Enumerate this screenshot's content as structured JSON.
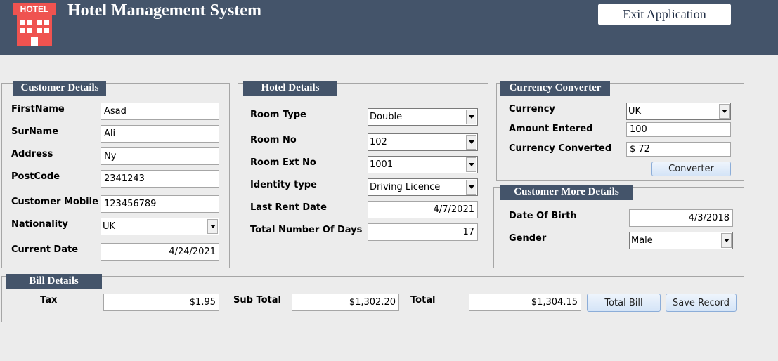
{
  "header": {
    "logo_text": "HOTEL",
    "title": "Hotel Management System",
    "exit_label": "Exit Application"
  },
  "customer": {
    "section_title": "Customer Details",
    "firstname_label": "FirstName",
    "firstname_value": "Asad",
    "surname_label": "SurName",
    "surname_value": "Ali",
    "address_label": "Address",
    "address_value": "Ny",
    "postcode_label": "PostCode",
    "postcode_value": "2341243",
    "mobile_label": "Customer Mobile",
    "mobile_value": "123456789",
    "nationality_label": "Nationality",
    "nationality_value": "UK",
    "current_date_label": "Current Date",
    "current_date_value": "4/24/2021"
  },
  "hotel": {
    "section_title": "Hotel Details",
    "room_type_label": "Room Type",
    "room_type_value": "Double",
    "room_no_label": "Room No",
    "room_no_value": "102",
    "room_ext_label": "Room Ext No",
    "room_ext_value": "1001",
    "identity_label": "Identity type",
    "identity_value": "Driving Licence",
    "last_rent_label": "Last Rent Date",
    "last_rent_value": "4/7/2021",
    "total_days_label": "Total Number Of Days",
    "total_days_value": "17"
  },
  "currency": {
    "section_title": "Currency Converter",
    "currency_label": "Currency",
    "currency_value": "UK",
    "amount_label": "Amount Entered",
    "amount_value": "100",
    "converted_label": "Currency Converted",
    "converted_value": "$ 72",
    "converter_button": "Converter"
  },
  "more": {
    "section_title": "Customer More Details",
    "dob_label": "Date Of Birth",
    "dob_value": "4/3/2018",
    "gender_label": "Gender",
    "gender_value": "Male"
  },
  "bill": {
    "section_title": "Bill Details",
    "tax_label": "Tax",
    "tax_value": "$1.95",
    "subtotal_label": "Sub Total",
    "subtotal_value": "$1,302.20",
    "total_label": "Total",
    "total_value": "$1,304.15",
    "total_bill_button": "Total Bill",
    "save_record_button": "Save Record"
  },
  "colors": {
    "header_bg": "#44546a",
    "section_title_bg": "#44546a",
    "background": "#ececec",
    "logo_red": "#ef5350"
  },
  "icons": {
    "logo": "hotel-building-icon",
    "dropdown": "chevron-down-icon"
  }
}
